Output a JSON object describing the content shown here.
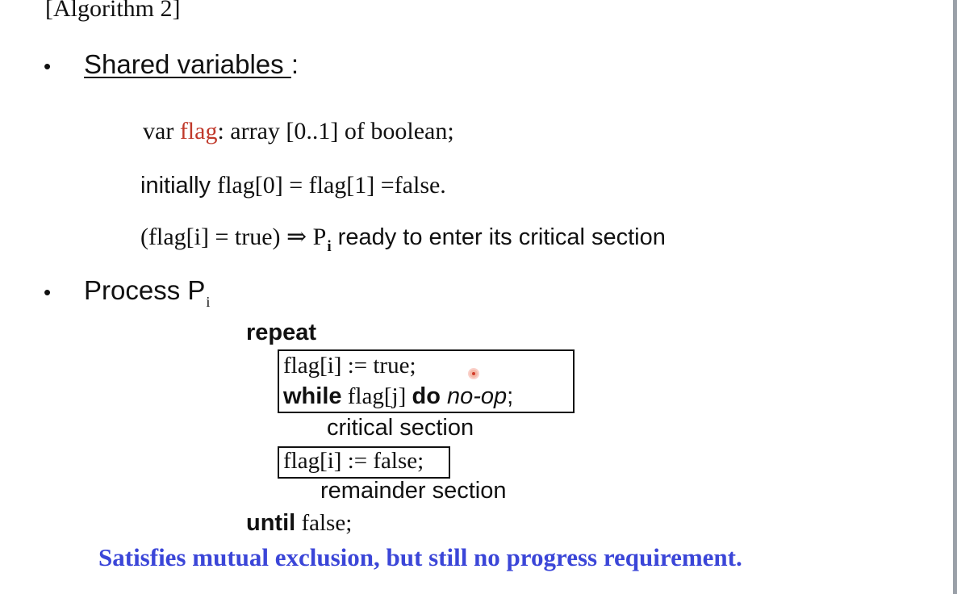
{
  "title": "[Algorithm 2]",
  "bullets": {
    "symbol": "•"
  },
  "shared": {
    "heading": "Shared variables ",
    "colon": ":",
    "decl_prefix": "var ",
    "decl_var": "flag",
    "decl_suffix": ": array [0..1] of boolean;",
    "init_word": "initially ",
    "init_rest": "flag[0] = flag[1] =false.",
    "meaning_prefix": "(flag[i] = true) ⇒ P",
    "meaning_sub": "i",
    "meaning_suffix": " ready to enter its critical section"
  },
  "process": {
    "heading": "Process P",
    "heading_sub": "i",
    "repeat": "repeat",
    "line1": "flag[i] := true;",
    "while_kw": "while",
    "while_cond": " flag[j] ",
    "do_kw": "do",
    "noop": " no-op",
    "semicolon": ";",
    "critical": "critical section",
    "line_reset": "flag[i] := false;",
    "remainder": "remainder section",
    "until_kw": "until",
    "until_rest": " false;"
  },
  "conclusion": "Satisfies mutual exclusion, but still no progress requirement.",
  "colors": {
    "accent_red": "#c0392b",
    "conclusion_blue": "#3b46d8",
    "cursor_red": "#d23c2a"
  }
}
